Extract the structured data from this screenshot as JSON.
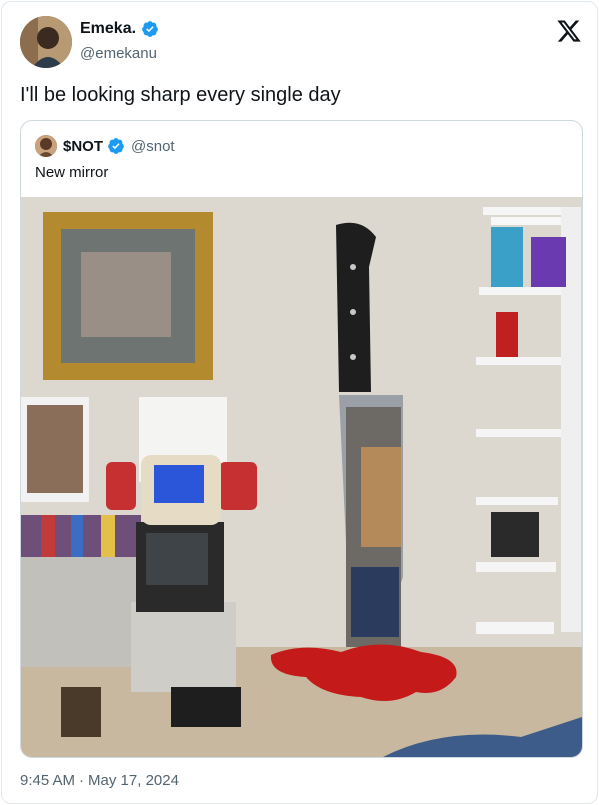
{
  "author": {
    "display_name": "Emeka.",
    "handle": "@emekanu",
    "avatar_icon": "user-avatar",
    "verified_icon": "verified-badge-icon"
  },
  "platform_icon": "x-logo-icon",
  "tweet": {
    "text": "I'll be looking sharp every single day",
    "time": "9:45 AM",
    "separator": "·",
    "date": "May 17, 2024"
  },
  "quoted": {
    "display_name": "$NOT",
    "handle": "@snot",
    "text": "New mirror",
    "image_icon": "room-photo-knife-mirror"
  },
  "colors": {
    "verified": "#1d9bf0",
    "secondary_text": "#536471",
    "border": "#cfd9de"
  }
}
